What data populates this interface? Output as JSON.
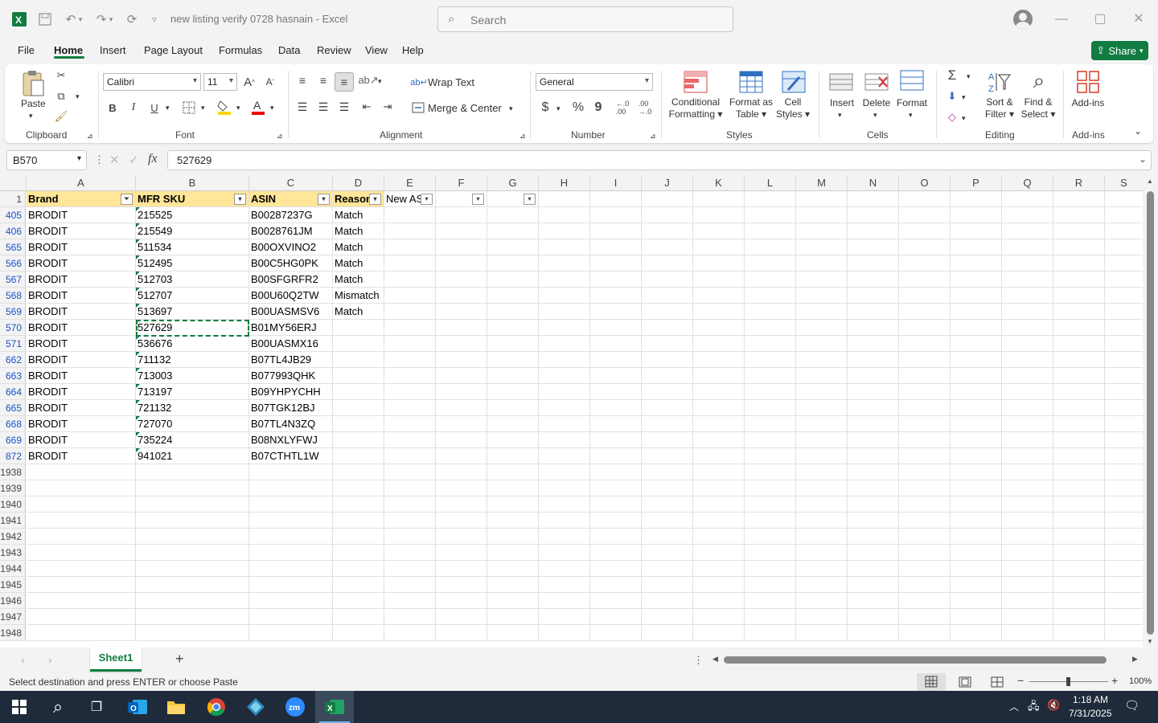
{
  "app": {
    "window_title": "new listing verify 0728 hasnain  -  Excel"
  },
  "search": {
    "placeholder": "Search"
  },
  "menu": {
    "tabs": [
      "File",
      "Home",
      "Insert",
      "Page Layout",
      "Formulas",
      "Data",
      "Review",
      "View",
      "Help"
    ],
    "share_label": "Share"
  },
  "ribbon": {
    "clipboard": {
      "paste": "Paste",
      "group": "Clipboard"
    },
    "font": {
      "name": "Calibri",
      "size": "11",
      "bold": "B",
      "italic": "I",
      "underline": "U",
      "group": "Font"
    },
    "alignment": {
      "wrap": "Wrap Text",
      "merge": "Merge & Center",
      "group": "Alignment"
    },
    "number": {
      "format": "General",
      "currency": "$",
      "percent": "%",
      "comma": "9",
      "group": "Number"
    },
    "styles": {
      "conditional_1": "Conditional",
      "conditional_2": "Formatting",
      "table_1": "Format as",
      "table_2": "Table",
      "cell_1": "Cell",
      "cell_2": "Styles",
      "group": "Styles"
    },
    "cells": {
      "insert": "Insert",
      "delete": "Delete",
      "format": "Format",
      "group": "Cells"
    },
    "editing": {
      "sort_1": "Sort &",
      "sort_2": "Filter",
      "find_1": "Find &",
      "find_2": "Select",
      "group": "Editing"
    },
    "addins": {
      "label": "Add-ins",
      "group": "Add-ins"
    }
  },
  "formula_bar": {
    "name_box": "B570",
    "fx": "fx",
    "value": "527629"
  },
  "columns": [
    "A",
    "B",
    "C",
    "D",
    "E",
    "F",
    "G",
    "H",
    "I",
    "J",
    "K",
    "L",
    "M",
    "N",
    "O",
    "P",
    "Q",
    "R",
    "S"
  ],
  "header_row": {
    "row": "1",
    "cells": [
      "Brand",
      "MFR SKU",
      "ASIN",
      "Reason",
      "New AS",
      "",
      ""
    ]
  },
  "rows": [
    {
      "row": "405",
      "brand": "BRODIT",
      "sku": "215525",
      "asin": "B00287237G",
      "reason": "Match"
    },
    {
      "row": "406",
      "brand": "BRODIT",
      "sku": "215549",
      "asin": "B0028761JM",
      "reason": "Match"
    },
    {
      "row": "565",
      "brand": "BRODIT",
      "sku": "511534",
      "asin": "B00OXVINO2",
      "reason": "Match"
    },
    {
      "row": "566",
      "brand": "BRODIT",
      "sku": "512495",
      "asin": "B00C5HG0PK",
      "reason": "Match"
    },
    {
      "row": "567",
      "brand": "BRODIT",
      "sku": "512703",
      "asin": "B00SFGRFR2",
      "reason": "Match"
    },
    {
      "row": "568",
      "brand": "BRODIT",
      "sku": "512707",
      "asin": "B00U60Q2TW",
      "reason": "Mismatch"
    },
    {
      "row": "569",
      "brand": "BRODIT",
      "sku": "513697",
      "asin": "B00UASMSV6",
      "reason": "Match"
    },
    {
      "row": "570",
      "brand": "BRODIT",
      "sku": "527629",
      "asin": "B01MY56ERJ",
      "reason": ""
    },
    {
      "row": "571",
      "brand": "BRODIT",
      "sku": "536676",
      "asin": "B00UASMX16",
      "reason": ""
    },
    {
      "row": "662",
      "brand": "BRODIT",
      "sku": "711132",
      "asin": "B07TL4JB29",
      "reason": ""
    },
    {
      "row": "663",
      "brand": "BRODIT",
      "sku": "713003",
      "asin": "B077993QHK",
      "reason": ""
    },
    {
      "row": "664",
      "brand": "BRODIT",
      "sku": "713197",
      "asin": "B09YHPYCHH",
      "reason": ""
    },
    {
      "row": "665",
      "brand": "BRODIT",
      "sku": "721132",
      "asin": "B07TGK12BJ",
      "reason": ""
    },
    {
      "row": "668",
      "brand": "BRODIT",
      "sku": "727070",
      "asin": "B07TL4N3ZQ",
      "reason": ""
    },
    {
      "row": "669",
      "brand": "BRODIT",
      "sku": "735224",
      "asin": "B08NXLYFWJ",
      "reason": ""
    },
    {
      "row": "872",
      "brand": "BRODIT",
      "sku": "941021",
      "asin": "B07CTHTL1W",
      "reason": ""
    }
  ],
  "empty_rows": [
    "1938",
    "1939",
    "1940",
    "1941",
    "1942",
    "1943",
    "1944",
    "1945",
    "1946",
    "1947",
    "1948"
  ],
  "sheet": {
    "active_tab": "Sheet1",
    "add_label": "+"
  },
  "status": {
    "message": "Select destination and press ENTER or choose Paste",
    "zoom": "100%"
  },
  "taskbar": {
    "time": "1:18 AM",
    "date": "7/31/2025"
  },
  "colors": {
    "accent": "#107c41",
    "header_fill": "#ffe699",
    "filtered_row_number": "#1f4fc4"
  }
}
